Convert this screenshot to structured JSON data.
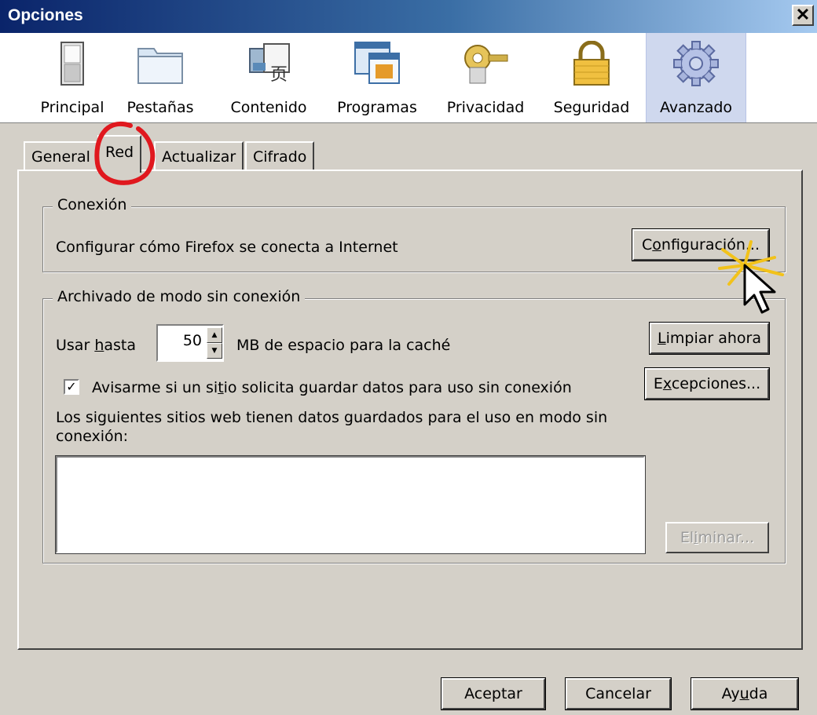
{
  "window": {
    "title": "Opciones",
    "close_glyph": "✕"
  },
  "toolbar": {
    "panes": [
      {
        "label": "Principal",
        "icon": "switch-icon"
      },
      {
        "label": "Pestañas",
        "icon": "folder-tabs-icon"
      },
      {
        "label": "Contenido",
        "icon": "content-icon"
      },
      {
        "label": "Programas",
        "icon": "applications-icon"
      },
      {
        "label": "Privacidad",
        "icon": "key-lock-icon"
      },
      {
        "label": "Seguridad",
        "icon": "padlock-icon"
      },
      {
        "label": "Avanzado",
        "icon": "gear-icon"
      }
    ],
    "selected": "Avanzado"
  },
  "tabs": [
    {
      "label": "General"
    },
    {
      "label": "Red"
    },
    {
      "label": "Actualizar"
    },
    {
      "label": "Cifrado"
    }
  ],
  "active_tab": "Red",
  "connection": {
    "legend": "Conexión",
    "description": "Configurar cómo Firefox se conecta a Internet",
    "settings_button": {
      "pre": "C",
      "accel": "o",
      "post": "nfiguración..."
    }
  },
  "offline": {
    "legend": "Archivado de modo sin conexión",
    "use_up_to": {
      "pre": "Usar ",
      "accel": "h",
      "post": "asta"
    },
    "cache_size": "50",
    "cache_units": "MB de espacio para la caché",
    "clear_button": {
      "pre": "",
      "accel": "L",
      "post": "impiar ahora"
    },
    "notify_checkbox": {
      "checked": true,
      "pre": "Avisarme si un si",
      "accel": "t",
      "post": "io solicita guardar datos para uso sin conexión"
    },
    "exceptions_button": {
      "pre": "E",
      "accel": "x",
      "post": "cepciones..."
    },
    "sites_label_line1": "Los siguientes sitios web tienen datos guardados para el uso en modo sin",
    "sites_label_line2": "conexión:",
    "remove_button": {
      "pre": "El",
      "accel": "i",
      "post": "minar...",
      "disabled": true
    }
  },
  "footer": {
    "accept": "Aceptar",
    "cancel": "Cancelar",
    "help": {
      "pre": "Ay",
      "accel": "u",
      "post": "da"
    }
  }
}
